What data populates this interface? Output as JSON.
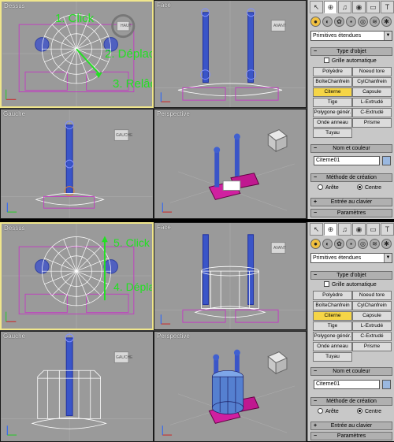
{
  "viewports": {
    "top": "Dessus",
    "front": "Face",
    "left": "Gauche",
    "perspective": "Perspective"
  },
  "view_cube": {
    "top": "HAUT",
    "front": "AVANT",
    "left": "GAUCHE"
  },
  "steps_top": {
    "click": "1. Click",
    "drag": "2. Déplace",
    "release": "3. Relâche"
  },
  "steps_bottom": {
    "click": "5. Click",
    "drag": "4. Déplace"
  },
  "panel": {
    "tabs": [
      "↖",
      "⊕",
      "♫",
      "◉",
      "▭",
      "T"
    ],
    "subtabs": [
      "●",
      "◐",
      "✿",
      "▪",
      "◎",
      "≋",
      "✱"
    ],
    "category": "Primitives étendues",
    "object_type_header": "Type d'objet",
    "autogrid": "Grille automatique",
    "buttons": [
      [
        "Polyèdre",
        "Noeud tore"
      ],
      [
        "BoîteChanfrein",
        "CylChanfrein"
      ],
      [
        "Citerne",
        "Capsule"
      ],
      [
        "Tige",
        "L-Extrudé"
      ],
      [
        "Polygone génér.",
        "C-Extrudé"
      ],
      [
        "Onde anneau",
        "Prisme"
      ],
      [
        "Tuyau",
        ""
      ]
    ],
    "selected_button": "Citerne",
    "name_color_header": "Nom et couleur",
    "object_name": "Citerne01",
    "swatch_color": "#9ab8e0",
    "creation_header": "Méthode de création",
    "method_edge": "Arête",
    "method_center": "Centre",
    "keyboard_entry": "Entrée au clavier",
    "parameters": "Paramètres"
  },
  "colors": {
    "step_text": "#22e022",
    "selected_button": "#f5d547",
    "active_border": "#f0e68c"
  }
}
